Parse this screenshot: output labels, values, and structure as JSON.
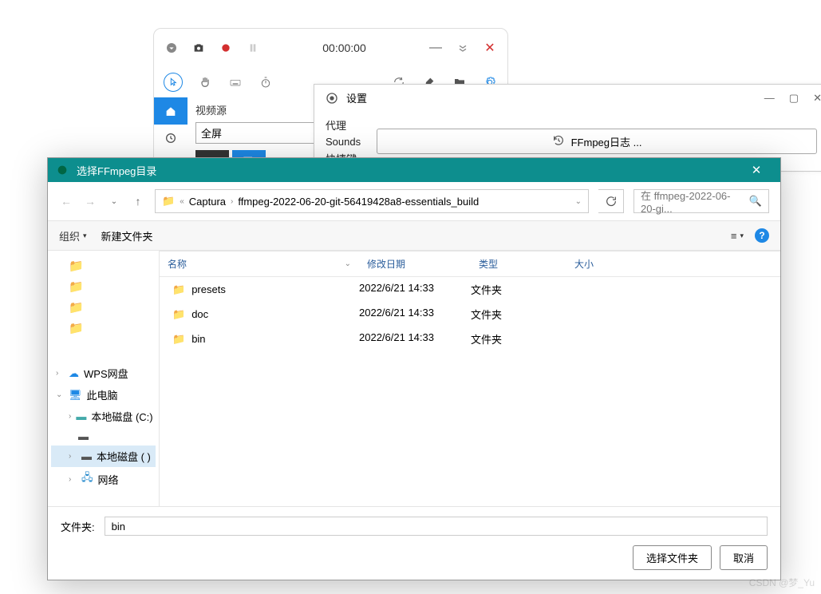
{
  "recorder": {
    "timer": "00:00:00",
    "source_label": "视频源",
    "source_value": "全屏"
  },
  "settings": {
    "title": "设置",
    "nav": {
      "proxy": "代理",
      "sounds": "Sounds",
      "hotkeys": "快捷键"
    },
    "ffmpeg_button": "FFmpeg日志 ..."
  },
  "picker": {
    "title": "选择FFmpeg目录",
    "crumbs": {
      "parent": "Captura",
      "current": "ffmpeg-2022-06-20-git-56419428a8-essentials_build"
    },
    "search_placeholder": "在 ffmpeg-2022-06-20-gi...",
    "toolbar": {
      "organize": "组织",
      "new_folder": "新建文件夹"
    },
    "headers": {
      "name": "名称",
      "date": "修改日期",
      "type": "类型",
      "size": "大小"
    },
    "tree": {
      "wps": "WPS网盘",
      "this_pc": "此电脑",
      "disk_c": "本地磁盘 (C:)",
      "disk_other": "本地磁盘 (   )",
      "network": "网络"
    },
    "files": [
      {
        "name": "presets",
        "date": "2022/6/21 14:33",
        "type": "文件夹",
        "size": ""
      },
      {
        "name": "doc",
        "date": "2022/6/21 14:33",
        "type": "文件夹",
        "size": ""
      },
      {
        "name": "bin",
        "date": "2022/6/21 14:33",
        "type": "文件夹",
        "size": ""
      }
    ],
    "folder_label": "文件夹:",
    "folder_value": "bin",
    "select_button": "选择文件夹",
    "cancel_button": "取消"
  },
  "watermark": "CSDN @梦_Yu"
}
